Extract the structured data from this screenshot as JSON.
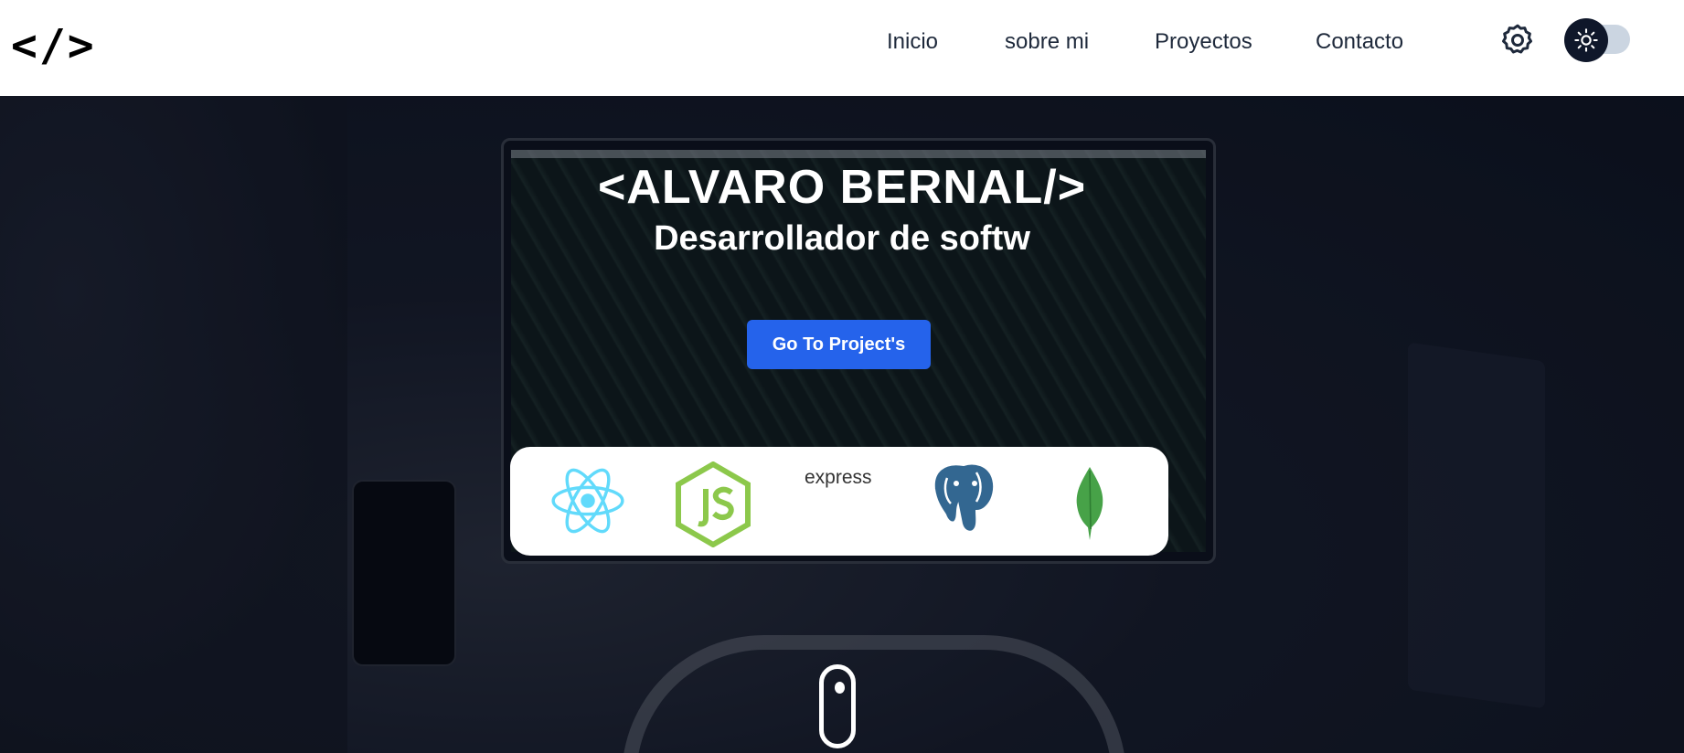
{
  "header": {
    "logo": "</>",
    "nav": [
      {
        "label": "Inicio"
      },
      {
        "label": "sobre mi"
      },
      {
        "label": "Proyectos"
      },
      {
        "label": "Contacto"
      }
    ]
  },
  "hero": {
    "title": "<ALVARO BERNAL/>",
    "subtitle": "Desarrollador de softw",
    "cta_label": "Go To Project's"
  },
  "tech_stack": {
    "items": [
      {
        "icon": "react-icon"
      },
      {
        "icon": "nodejs-icon"
      },
      {
        "label": "express",
        "icon": "express-icon"
      },
      {
        "icon": "postgresql-icon"
      },
      {
        "icon": "mongodb-icon"
      }
    ]
  },
  "colors": {
    "accent": "#2563eb",
    "header_bg": "#ffffff",
    "toggle_knob": "#0f172a",
    "react": "#61dafb",
    "node": "#8cc84b",
    "postgres": "#336791",
    "mongo": "#47a248"
  }
}
